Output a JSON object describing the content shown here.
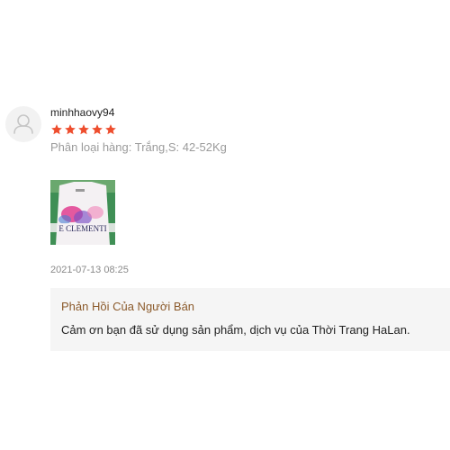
{
  "review": {
    "username": "minhhaovy94",
    "rating": 5,
    "star_color": "#ee4d2d",
    "variation": "Phân loại hàng: Trắng,S: 42-52Kg",
    "photo_text": "E CLEMENTI",
    "time": "2021-07-13 08:25",
    "avatar_icon": "user-icon"
  },
  "seller_reply": {
    "title": "Phản Hồi Của Người Bán",
    "text": "Cảm ơn bạn đã sử dụng sản phẩm, dịch vụ của Thời Trang HaLan."
  }
}
